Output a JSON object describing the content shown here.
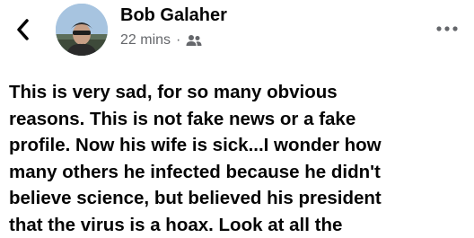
{
  "post": {
    "author": "Bob Galaher",
    "timestamp": "22 mins",
    "separator": "·",
    "audience_icon": "friends-icon",
    "back_icon": "chevron-left-icon",
    "more_icon": "more-horizontal-icon",
    "text": "This is very sad, for so many obvious\nreasons. This is not fake news or a fake\nprofile. Now his wife is sick...I wonder how\nmany others he infected because he didn't\nbelieve science, but believed his president\nthat the virus is a hoax. Look at all the"
  },
  "colors": {
    "text": "#050505",
    "secondary_text": "#65676b",
    "background": "#ffffff"
  }
}
